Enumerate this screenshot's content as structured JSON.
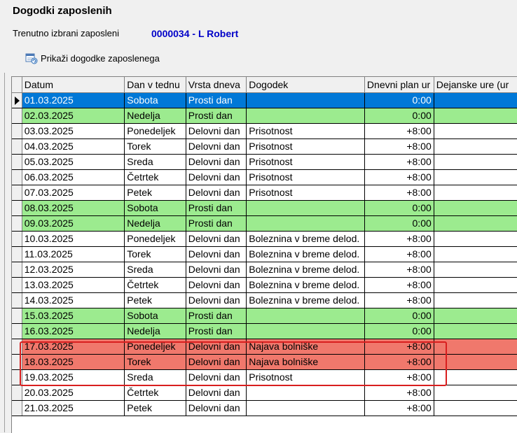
{
  "window": {
    "title": "Dogodki zaposlenih"
  },
  "employee": {
    "label": "Trenutno izbrani zaposleni",
    "value": "0000034 - L Robert"
  },
  "action": {
    "label": "Prikaži dogodke zaposlenega",
    "icon": "calendar-refresh-icon"
  },
  "colors": {
    "selected": "#0078d7",
    "weekend": "#9ceb8f",
    "highlight": "#f0786c",
    "highlight_border": "#d81e1e",
    "employee_text": "#0000c8"
  },
  "grid": {
    "columns": [
      "Datum",
      "Dan v tednu",
      "Vrsta dneva",
      "Dogodek",
      "Dnevni plan ur",
      "Dejanske ure (ur"
    ],
    "rows": [
      {
        "date": "01.03.2025",
        "day": "Sobota",
        "type": "Prosti dan",
        "event": "",
        "plan": "0:00",
        "actual": "",
        "style": "selected"
      },
      {
        "date": "02.03.2025",
        "day": "Nedelja",
        "type": "Prosti dan",
        "event": "",
        "plan": "0:00",
        "actual": "",
        "style": "weekend"
      },
      {
        "date": "03.03.2025",
        "day": "Ponedeljek",
        "type": "Delovni dan",
        "event": "Prisotnost",
        "plan": "+8:00",
        "actual": "",
        "style": ""
      },
      {
        "date": "04.03.2025",
        "day": "Torek",
        "type": "Delovni dan",
        "event": "Prisotnost",
        "plan": "+8:00",
        "actual": "",
        "style": ""
      },
      {
        "date": "05.03.2025",
        "day": "Sreda",
        "type": "Delovni dan",
        "event": "Prisotnost",
        "plan": "+8:00",
        "actual": "",
        "style": ""
      },
      {
        "date": "06.03.2025",
        "day": "Četrtek",
        "type": "Delovni dan",
        "event": "Prisotnost",
        "plan": "+8:00",
        "actual": "",
        "style": ""
      },
      {
        "date": "07.03.2025",
        "day": "Petek",
        "type": "Delovni dan",
        "event": "Prisotnost",
        "plan": "+8:00",
        "actual": "",
        "style": ""
      },
      {
        "date": "08.03.2025",
        "day": "Sobota",
        "type": "Prosti dan",
        "event": "",
        "plan": "0:00",
        "actual": "",
        "style": "weekend"
      },
      {
        "date": "09.03.2025",
        "day": "Nedelja",
        "type": "Prosti dan",
        "event": "",
        "plan": "0:00",
        "actual": "",
        "style": "weekend"
      },
      {
        "date": "10.03.2025",
        "day": "Ponedeljek",
        "type": "Delovni dan",
        "event": "Boleznina v breme delod.",
        "plan": "+8:00",
        "actual": "",
        "style": ""
      },
      {
        "date": "11.03.2025",
        "day": "Torek",
        "type": "Delovni dan",
        "event": "Boleznina v breme delod.",
        "plan": "+8:00",
        "actual": "",
        "style": ""
      },
      {
        "date": "12.03.2025",
        "day": "Sreda",
        "type": "Delovni dan",
        "event": "Boleznina v breme delod.",
        "plan": "+8:00",
        "actual": "",
        "style": ""
      },
      {
        "date": "13.03.2025",
        "day": "Četrtek",
        "type": "Delovni dan",
        "event": "Boleznina v breme delod.",
        "plan": "+8:00",
        "actual": "",
        "style": ""
      },
      {
        "date": "14.03.2025",
        "day": "Petek",
        "type": "Delovni dan",
        "event": "Boleznina v breme delod.",
        "plan": "+8:00",
        "actual": "",
        "style": ""
      },
      {
        "date": "15.03.2025",
        "day": "Sobota",
        "type": "Prosti dan",
        "event": "",
        "plan": "0:00",
        "actual": "",
        "style": "weekend"
      },
      {
        "date": "16.03.2025",
        "day": "Nedelja",
        "type": "Prosti dan",
        "event": "",
        "plan": "0:00",
        "actual": "",
        "style": "weekend"
      },
      {
        "date": "17.03.2025",
        "day": "Ponedeljek",
        "type": "Delovni dan",
        "event": "Najava bolniške",
        "plan": "+8:00",
        "actual": "",
        "style": "highlight"
      },
      {
        "date": "18.03.2025",
        "day": "Torek",
        "type": "Delovni dan",
        "event": "Najava bolniške",
        "plan": "+8:00",
        "actual": "",
        "style": "highlight"
      },
      {
        "date": "19.03.2025",
        "day": "Sreda",
        "type": "Delovni dan",
        "event": "Prisotnost",
        "plan": "+8:00",
        "actual": "",
        "style": ""
      },
      {
        "date": "20.03.2025",
        "day": "Četrtek",
        "type": "Delovni dan",
        "event": "",
        "plan": "+8:00",
        "actual": "",
        "style": ""
      },
      {
        "date": "21.03.2025",
        "day": "Petek",
        "type": "Delovni dan",
        "event": "",
        "plan": "+8:00",
        "actual": "",
        "style": ""
      }
    ]
  }
}
